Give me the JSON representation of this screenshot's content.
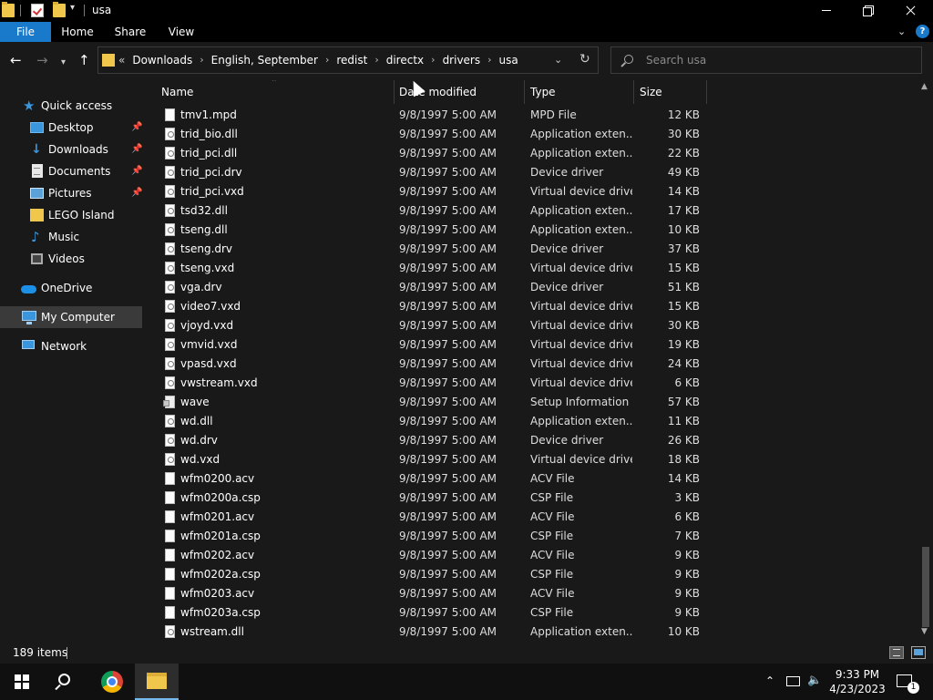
{
  "window": {
    "title": "usa",
    "controls": {
      "minimize": "minimize",
      "maximize": "maximize",
      "close": "close"
    }
  },
  "ribbon": {
    "tabs": [
      "File",
      "Home",
      "Share",
      "View"
    ]
  },
  "address": {
    "overflow": "«",
    "crumbs": [
      "Downloads",
      "English, September",
      "redist",
      "directx",
      "drivers",
      "usa"
    ]
  },
  "search": {
    "placeholder": "Search usa",
    "value": ""
  },
  "sidebar": {
    "items": [
      {
        "label": "Quick access",
        "icon": "star-icon",
        "pinned": false
      },
      {
        "label": "Desktop",
        "icon": "desktop-icon",
        "pinned": true
      },
      {
        "label": "Downloads",
        "icon": "download-icon",
        "pinned": true
      },
      {
        "label": "Documents",
        "icon": "documents-icon",
        "pinned": true
      },
      {
        "label": "Pictures",
        "icon": "pictures-icon",
        "pinned": true
      },
      {
        "label": "LEGO Island",
        "icon": "folder-icon",
        "pinned": false
      },
      {
        "label": "Music",
        "icon": "music-icon",
        "pinned": false
      },
      {
        "label": "Videos",
        "icon": "videos-icon",
        "pinned": false
      },
      {
        "label": "OneDrive",
        "icon": "cloud-icon",
        "pinned": false
      },
      {
        "label": "My Computer",
        "icon": "computer-icon",
        "pinned": false,
        "selected": true
      },
      {
        "label": "Network",
        "icon": "network-icon",
        "pinned": false
      }
    ]
  },
  "columns": {
    "name": "Name",
    "date": "Date modified",
    "type": "Type",
    "size": "Size"
  },
  "files": [
    {
      "name": "tmv1.mpd",
      "date": "9/8/1997 5:00 AM",
      "type": "MPD File",
      "size": "12 KB",
      "kind": "plain"
    },
    {
      "name": "trid_bio.dll",
      "date": "9/8/1997 5:00 AM",
      "type": "Application exten...",
      "size": "30 KB",
      "kind": "sys"
    },
    {
      "name": "trid_pci.dll",
      "date": "9/8/1997 5:00 AM",
      "type": "Application exten...",
      "size": "22 KB",
      "kind": "sys"
    },
    {
      "name": "trid_pci.drv",
      "date": "9/8/1997 5:00 AM",
      "type": "Device driver",
      "size": "49 KB",
      "kind": "sys"
    },
    {
      "name": "trid_pci.vxd",
      "date": "9/8/1997 5:00 AM",
      "type": "Virtual device driver",
      "size": "14 KB",
      "kind": "sys"
    },
    {
      "name": "tsd32.dll",
      "date": "9/8/1997 5:00 AM",
      "type": "Application exten...",
      "size": "17 KB",
      "kind": "sys"
    },
    {
      "name": "tseng.dll",
      "date": "9/8/1997 5:00 AM",
      "type": "Application exten...",
      "size": "10 KB",
      "kind": "sys"
    },
    {
      "name": "tseng.drv",
      "date": "9/8/1997 5:00 AM",
      "type": "Device driver",
      "size": "37 KB",
      "kind": "sys"
    },
    {
      "name": "tseng.vxd",
      "date": "9/8/1997 5:00 AM",
      "type": "Virtual device driver",
      "size": "15 KB",
      "kind": "sys"
    },
    {
      "name": "vga.drv",
      "date": "9/8/1997 5:00 AM",
      "type": "Device driver",
      "size": "51 KB",
      "kind": "sys"
    },
    {
      "name": "video7.vxd",
      "date": "9/8/1997 5:00 AM",
      "type": "Virtual device driver",
      "size": "15 KB",
      "kind": "sys"
    },
    {
      "name": "vjoyd.vxd",
      "date": "9/8/1997 5:00 AM",
      "type": "Virtual device driver",
      "size": "30 KB",
      "kind": "sys"
    },
    {
      "name": "vmvid.vxd",
      "date": "9/8/1997 5:00 AM",
      "type": "Virtual device driver",
      "size": "19 KB",
      "kind": "sys"
    },
    {
      "name": "vpasd.vxd",
      "date": "9/8/1997 5:00 AM",
      "type": "Virtual device driver",
      "size": "24 KB",
      "kind": "sys"
    },
    {
      "name": "vwstream.vxd",
      "date": "9/8/1997 5:00 AM",
      "type": "Virtual device driver",
      "size": "6 KB",
      "kind": "sys"
    },
    {
      "name": "wave",
      "date": "9/8/1997 5:00 AM",
      "type": "Setup Information",
      "size": "57 KB",
      "kind": "inf"
    },
    {
      "name": "wd.dll",
      "date": "9/8/1997 5:00 AM",
      "type": "Application exten...",
      "size": "11 KB",
      "kind": "sys"
    },
    {
      "name": "wd.drv",
      "date": "9/8/1997 5:00 AM",
      "type": "Device driver",
      "size": "26 KB",
      "kind": "sys"
    },
    {
      "name": "wd.vxd",
      "date": "9/8/1997 5:00 AM",
      "type": "Virtual device driver",
      "size": "18 KB",
      "kind": "sys"
    },
    {
      "name": "wfm0200.acv",
      "date": "9/8/1997 5:00 AM",
      "type": "ACV File",
      "size": "14 KB",
      "kind": "plain"
    },
    {
      "name": "wfm0200a.csp",
      "date": "9/8/1997 5:00 AM",
      "type": "CSP File",
      "size": "3 KB",
      "kind": "plain"
    },
    {
      "name": "wfm0201.acv",
      "date": "9/8/1997 5:00 AM",
      "type": "ACV File",
      "size": "6 KB",
      "kind": "plain"
    },
    {
      "name": "wfm0201a.csp",
      "date": "9/8/1997 5:00 AM",
      "type": "CSP File",
      "size": "7 KB",
      "kind": "plain"
    },
    {
      "name": "wfm0202.acv",
      "date": "9/8/1997 5:00 AM",
      "type": "ACV File",
      "size": "9 KB",
      "kind": "plain"
    },
    {
      "name": "wfm0202a.csp",
      "date": "9/8/1997 5:00 AM",
      "type": "CSP File",
      "size": "9 KB",
      "kind": "plain"
    },
    {
      "name": "wfm0203.acv",
      "date": "9/8/1997 5:00 AM",
      "type": "ACV File",
      "size": "9 KB",
      "kind": "plain"
    },
    {
      "name": "wfm0203a.csp",
      "date": "9/8/1997 5:00 AM",
      "type": "CSP File",
      "size": "9 KB",
      "kind": "plain"
    },
    {
      "name": "wstream.dll",
      "date": "9/8/1997 5:00 AM",
      "type": "Application exten...",
      "size": "10 KB",
      "kind": "sys"
    }
  ],
  "status": {
    "item_count": "189 items"
  },
  "taskbar": {
    "clock_time": "9:33 PM",
    "clock_date": "4/23/2023",
    "notification_count": "1"
  },
  "colors": {
    "accent": "#1979ca",
    "background": "#191919",
    "chrome": "#000000",
    "folder": "#f0c64b"
  }
}
